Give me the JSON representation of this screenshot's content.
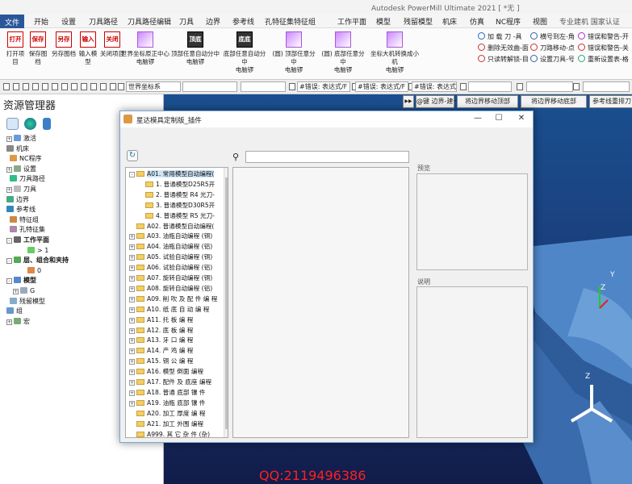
{
  "window": {
    "title": "Autodesk PowerMill Ultimate 2021   [ *无 ]"
  },
  "menu": {
    "file": "文件",
    "items": [
      "开始",
      "设置",
      "刀具路径",
      "刀具路径编辑",
      "刀具",
      "边界",
      "参考线",
      "孔特征集",
      "特征组",
      "工作平面",
      "模型",
      "残留模型",
      "机床",
      "仿真",
      "NC程序",
      "视图"
    ],
    "right": "专业建机 国家认证"
  },
  "ribbon": {
    "buttons": [
      {
        "icon": "打开",
        "label": "打开项目"
      },
      {
        "icon": "保存",
        "label": "保存图档"
      },
      {
        "icon": "另存",
        "label": "另存图档"
      },
      {
        "icon": "输入",
        "label": "输入模型"
      },
      {
        "icon": "关闭",
        "label": "关闭项目"
      },
      {
        "icon": "",
        "label": "世界坐标原正中心\n电脑锣"
      },
      {
        "icon": "顶底",
        "label": "顶部任意自动分中\n电脑锣"
      },
      {
        "icon": "底底",
        "label": "底部任意自动分中\n电脑锣"
      },
      {
        "icon": "",
        "label": "(圆) 顶部任意分中\n电脑锣"
      },
      {
        "icon": "",
        "label": "(圆) 底部任意分中\n电脑锣"
      },
      {
        "icon": "",
        "label": "坐标大机转换成小机\n电脑锣"
      }
    ],
    "small": [
      "加 载 刀 -具",
      "删除无效曲-面",
      "只读转解锁-目",
      "横号到左-角",
      "刀路移动-点",
      "设置刀具-号",
      "错误和警告-开",
      "错误和警告-关",
      "重新设置表-格"
    ]
  },
  "toolbar": {
    "coord": "世界坐标系",
    "err1": "#错误: 表达式/F",
    "err2": "#错误: 表达式/F",
    "err3": "#错误: 表达式/F"
  },
  "explorer": {
    "title": "资源管理器",
    "items": [
      {
        "label": "激活",
        "color": "#6a9ad8",
        "pm": "+"
      },
      {
        "label": "机床",
        "color": "#888",
        "pm": ""
      },
      {
        "label": "NC程序",
        "color": "#d94",
        "pm": ""
      },
      {
        "label": "设置",
        "color": "#8a8",
        "pm": "+"
      },
      {
        "label": "刀具路径",
        "color": "#3b8",
        "pm": ""
      },
      {
        "label": "刀具",
        "color": "#bbb",
        "pm": "+"
      },
      {
        "label": "边界",
        "color": "#4a8",
        "pm": ""
      },
      {
        "label": "参考线",
        "color": "#38b",
        "pm": ""
      },
      {
        "label": "特征组",
        "color": "#c84",
        "pm": ""
      },
      {
        "label": "孔特征集",
        "color": "#a8a",
        "pm": ""
      },
      {
        "label": "工作平面",
        "color": "#666",
        "pm": "-"
      },
      {
        "label": "> 1",
        "color": "#6c6",
        "pm": ""
      },
      {
        "label": "层、组合和夹持",
        "color": "#5a5",
        "pm": "-"
      },
      {
        "label": "0",
        "color": "#d84",
        "pm": ""
      },
      {
        "label": "模型",
        "color": "#58c",
        "pm": "-"
      },
      {
        "label": "G",
        "color": "#9ab",
        "pm": "+"
      },
      {
        "label": "残留模型",
        "color": "#8ac",
        "pm": ""
      },
      {
        "label": "组",
        "color": "#69c",
        "pm": ""
      },
      {
        "label": "宏",
        "color": "#7a7",
        "pm": "+"
      }
    ]
  },
  "viewport": {
    "buttons": [
      "@键 边界-建一毛坯",
      "将边界移动顶部",
      "将边界移动底部",
      "参考线重排刀"
    ],
    "watermark": "QQ:2119496386",
    "axis_y": "Y",
    "axis_z": "Z",
    "axis_z2": "Z"
  },
  "dialog": {
    "title": "星达模具定制版_插件",
    "preview_label": "预览",
    "desc_label": "说明",
    "search_value": "",
    "tree": [
      {
        "label": "A01. 常用模型自动编程(",
        "level": 0,
        "pm": "-",
        "sel": true
      },
      {
        "label": "1. 普通模型D25R5开",
        "level": 1,
        "pm": ""
      },
      {
        "label": "2. 普通模型 R4 光刀-",
        "level": 1,
        "pm": ""
      },
      {
        "label": "3. 普通模型D30R5开",
        "level": 1,
        "pm": ""
      },
      {
        "label": "4. 普通模型 R5 光刀-",
        "level": 1,
        "pm": ""
      },
      {
        "label": "A02. 普通模型自动编程(",
        "level": 0,
        "pm": ""
      },
      {
        "label": "A03. 油瓶自动编程 (铜)",
        "level": 0,
        "pm": "+"
      },
      {
        "label": "A04. 油瓶自动编程 (铝)",
        "level": 0,
        "pm": "+"
      },
      {
        "label": "A05. 试验自动编程 (铜)",
        "level": 0,
        "pm": "+"
      },
      {
        "label": "A06. 试验自动编程 (铝)",
        "level": 0,
        "pm": "+"
      },
      {
        "label": "A07. 旋转自动编程 (铜)",
        "level": 0,
        "pm": "+"
      },
      {
        "label": "A08. 旋转自动编程 (铝)",
        "level": 0,
        "pm": "+"
      },
      {
        "label": "A09. 削 吹 及 配 件 编 程",
        "level": 0,
        "pm": "+"
      },
      {
        "label": "A10. 纸 底 自 动 编 程",
        "level": 0,
        "pm": "+"
      },
      {
        "label": "A11. 托  板  编  程",
        "level": 0,
        "pm": "+"
      },
      {
        "label": "A12. 底  板  编  程",
        "level": 0,
        "pm": "+"
      },
      {
        "label": "A13. 牙  口  编  程",
        "level": 0,
        "pm": "+"
      },
      {
        "label": "A14. 产  鸡  编  程",
        "level": 0,
        "pm": "+"
      },
      {
        "label": "A15. 铜  公  编  程",
        "level": 0,
        "pm": "+"
      },
      {
        "label": "A16. 模型 倒面 编程",
        "level": 0,
        "pm": "+"
      },
      {
        "label": "A17. 配件 及 底座 编程",
        "level": 0,
        "pm": "+"
      },
      {
        "label": "A18. 普通 底部 镶 件",
        "level": 0,
        "pm": "+"
      },
      {
        "label": "A19. 油瓶 底部 镶 件",
        "level": 0,
        "pm": "+"
      },
      {
        "label": "A20. 加工 厚度 编 程",
        "level": 0,
        "pm": ""
      },
      {
        "label": "A21. 加工 外围 编程",
        "level": 0,
        "pm": ""
      },
      {
        "label": "A999. 其 它 杂 件 (杂)",
        "level": 0,
        "pm": ""
      }
    ]
  }
}
